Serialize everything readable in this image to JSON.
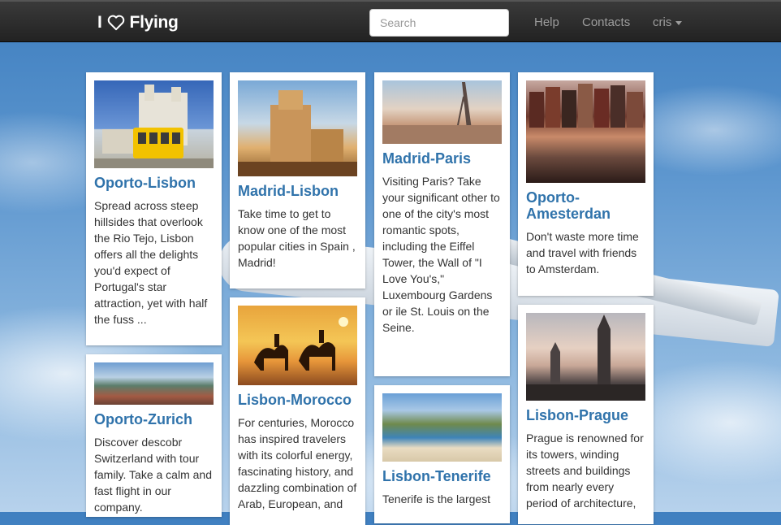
{
  "navbar": {
    "brand_prefix": "I",
    "brand_name": "Flying",
    "search_placeholder": "Search",
    "links": [
      "Help",
      "Contacts"
    ],
    "user": "cris"
  },
  "cards": [
    {
      "title": "Oporto-Lisbon",
      "text": "Spread across steep hillsides that overlook the Rio Tejo, Lisbon offers all the delights you'd expect of Portugal's star attraction, yet with half the fuss ..."
    },
    {
      "title": "Madrid-Lisbon",
      "text": "Take time to get to know one of the most popular cities in Spain , Madrid!"
    },
    {
      "title": "Madrid-Paris",
      "text": "Visiting Paris? Take your significant other to one of the city's most romantic spots, including the Eiffel Tower, the Wall of \"I Love You's,\" Luxembourg Gardens or ile St. Louis on the Seine."
    },
    {
      "title": "Oporto-Amesterdan",
      "text": "Don't waste more time and travel with friends to Amsterdam."
    },
    {
      "title": "Oporto-Zurich",
      "text": "Discover descobr Switzerland with tour family. Take a calm and fast flight in our company."
    },
    {
      "title": "Lisbon-Morocco",
      "text": "For centuries, Morocco has inspired travelers with its colorful energy, fascinating history, and dazzling combination of Arab, European, and"
    },
    {
      "title": "Lisbon-Tenerife",
      "text": "Tenerife is the largest"
    },
    {
      "title": "Lisbon-Prague",
      "text": "Prague is renowned for its towers, winding streets and buildings from nearly every period of architecture,"
    }
  ]
}
